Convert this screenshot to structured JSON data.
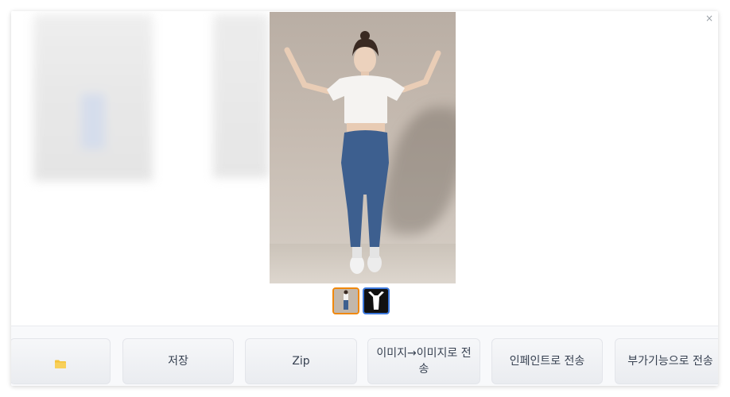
{
  "modal": {
    "close_label": "×"
  },
  "gallery": {
    "selected_index": 0,
    "thumbnails": [
      {
        "name": "thumbnail-1",
        "selected": true
      },
      {
        "name": "thumbnail-2",
        "selected": false
      }
    ]
  },
  "actions": {
    "folder_icon": "folder-icon",
    "save_label": "저장",
    "zip_label": "Zip",
    "i2i_label": "이미지→이미지로 전송",
    "inpaint_label": "인페인트로 전송",
    "extras_label": "부가기능으로 전송"
  },
  "colors": {
    "selected_thumb_border": "#f0880c",
    "second_thumb_border": "#3c78dc",
    "folder_icon": "#f5c33b",
    "button_text": "#374151"
  }
}
